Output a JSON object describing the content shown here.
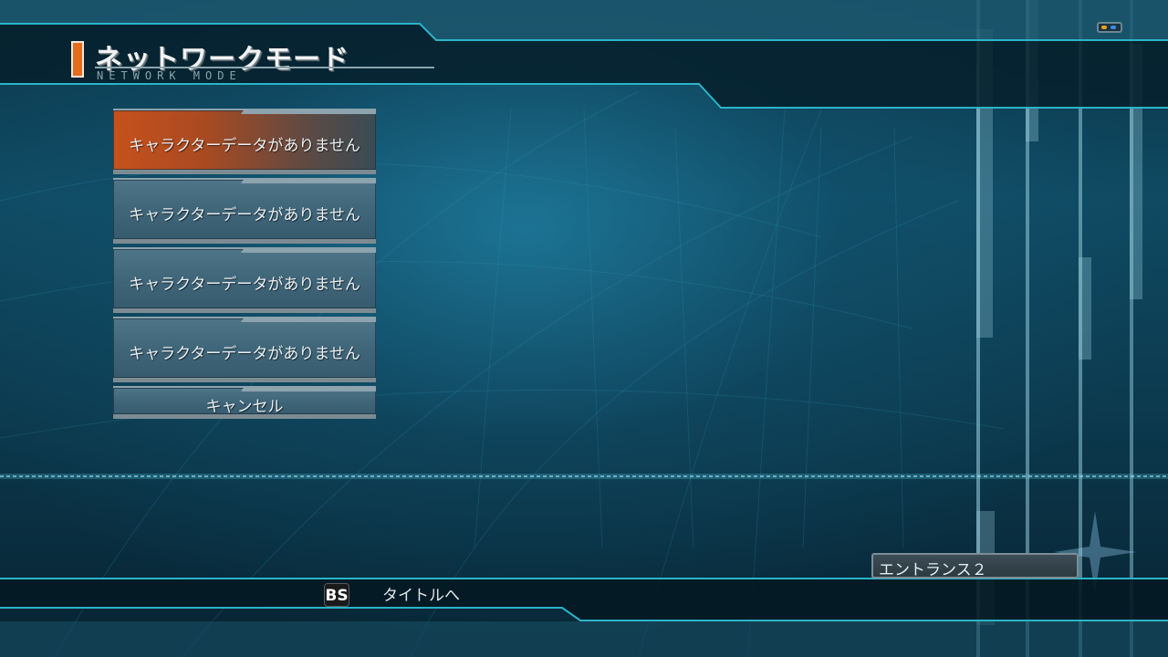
{
  "header": {
    "title": "ネットワークモード",
    "subtitle": "NETWORK MODE"
  },
  "menu": {
    "items": [
      {
        "label": "キャラクターデータがありません",
        "selected": true
      },
      {
        "label": "キャラクターデータがありません",
        "selected": false
      },
      {
        "label": "キャラクターデータがありません",
        "selected": false
      },
      {
        "label": "キャラクターデータがありません",
        "selected": false
      }
    ],
    "cancel_label": "キャンセル"
  },
  "footer": {
    "key_label": "BS",
    "key_action": "タイトルへ"
  },
  "location": {
    "name": "エントランス２"
  },
  "colors": {
    "accent": "#e56b1f",
    "background": "#0f4a62",
    "line": "#2bb4c8"
  },
  "icons": [
    "controller-status-icon"
  ]
}
